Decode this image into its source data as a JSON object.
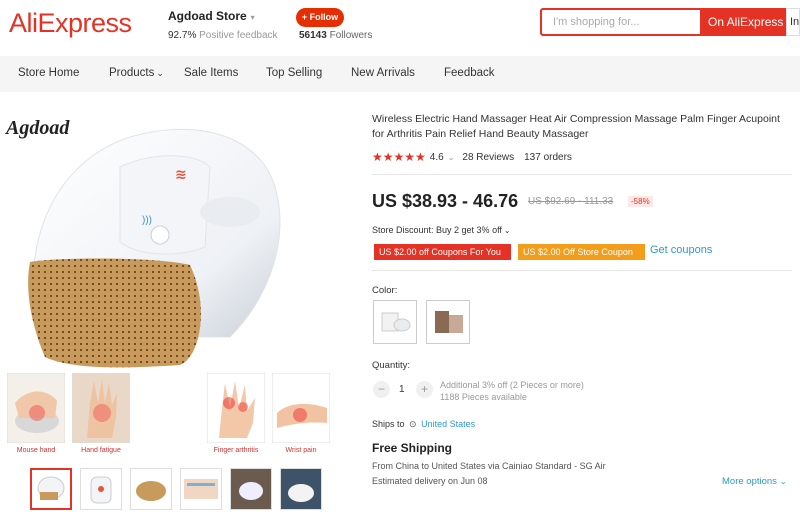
{
  "header": {
    "logo": "AliExpress",
    "store_name": "Agdoad Store",
    "positive_feedback_value": "92.7%",
    "positive_feedback_label": "Positive feedback",
    "follow_label": "+ Follow",
    "followers_count": "56143",
    "followers_label": "Followers",
    "search_placeholder": "I'm shopping for...",
    "search_button": "On AliExpress",
    "search_button2": "In"
  },
  "nav": {
    "items": [
      "Store Home",
      "Products",
      "Sale Items",
      "Top Selling",
      "New Arrivals",
      "Feedback"
    ]
  },
  "gallery": {
    "brand": "Agdoad",
    "categories": [
      "Mouse hand",
      "Hand fatigue",
      "Finger arthritis",
      "Wrist pain"
    ]
  },
  "product": {
    "title": "Wireless Electric Hand Massager Heat Air Compression Massage Palm Finger Acupoint for Arthritis Pain Relief Hand Beauty Massager",
    "rating_value": "4.6",
    "reviews": "28 Reviews",
    "orders": "137 orders",
    "price": "US $38.93 - 46.76",
    "old_price": "US $92.69 - 111.33",
    "discount_pct": "-58%",
    "store_discount": "Store Discount: Buy 2 get 3% off",
    "coupon1": "US $2.00 off Coupons For You",
    "coupon2": "US $2.00 Off Store Coupon",
    "get_coupons": "Get coupons",
    "color_label": "Color:",
    "quantity_label": "Quantity:",
    "quantity_value": "1",
    "qty_note1": "Additional 3% off (2 Pieces or more)",
    "qty_note2": "1188 Pieces available",
    "ships_to_label": "Ships to",
    "ships_to_location": "United States",
    "free_shipping": "Free Shipping",
    "shipping_line": "From China to United States via Cainiao Standard - SG Air",
    "estimated_delivery": "Estimated delivery on Jun 08",
    "more_options": "More options"
  },
  "colors": {
    "accent": "#e43225",
    "link": "#2e9cc3",
    "coupon_orange": "#f29e1c"
  }
}
